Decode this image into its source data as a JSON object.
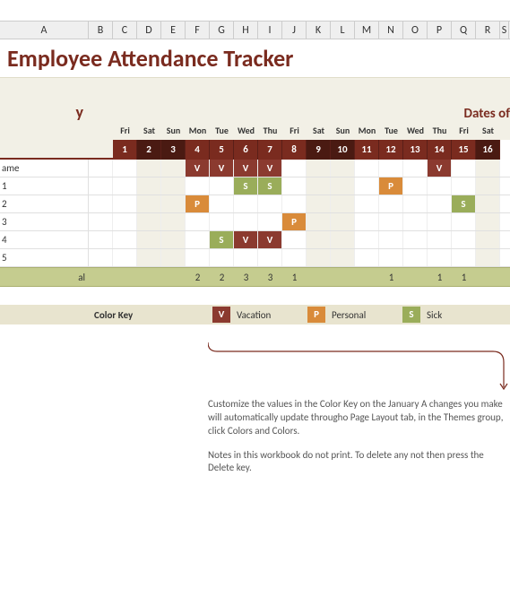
{
  "columns": [
    "A",
    "B",
    "C",
    "D",
    "E",
    "F",
    "G",
    "H",
    "I",
    "J",
    "K",
    "L",
    "M",
    "N",
    "O",
    "P",
    "Q",
    "R",
    "S"
  ],
  "title": "Employee Attendance Tracker",
  "month_suffix": "y",
  "dates_label": "Dates of",
  "dow": [
    "Fri",
    "Sat",
    "Sun",
    "Mon",
    "Tue",
    "Wed",
    "Thu",
    "Fri",
    "Sat",
    "Sun",
    "Mon",
    "Tue",
    "Wed",
    "Thu",
    "Fri",
    "Sat"
  ],
  "daynums": [
    "1",
    "2",
    "3",
    "4",
    "5",
    "6",
    "7",
    "8",
    "9",
    "10",
    "11",
    "12",
    "13",
    "14",
    "15",
    "16"
  ],
  "weekend_idx": [
    1,
    2,
    8,
    9,
    15
  ],
  "employees": [
    {
      "name": "ame",
      "cells": [
        "",
        "",
        "",
        "V",
        "V",
        "V",
        "V",
        "",
        "",
        "",
        "",
        "",
        "",
        "V",
        "",
        ""
      ]
    },
    {
      "name": "1",
      "cells": [
        "",
        "",
        "",
        "",
        "",
        "S",
        "S",
        "",
        "",
        "",
        "",
        "P",
        "",
        "",
        "",
        ""
      ]
    },
    {
      "name": "2",
      "cells": [
        "",
        "",
        "",
        "P",
        "",
        "",
        "",
        "",
        "",
        "",
        "",
        "",
        "",
        "",
        "S",
        ""
      ]
    },
    {
      "name": "3",
      "cells": [
        "",
        "",
        "",
        "",
        "",
        "",
        "",
        "P",
        "",
        "",
        "",
        "",
        "",
        "",
        "",
        ""
      ]
    },
    {
      "name": "4",
      "cells": [
        "",
        "",
        "",
        "",
        "S",
        "V",
        "V",
        "",
        "",
        "",
        "",
        "",
        "",
        "",
        "",
        ""
      ]
    },
    {
      "name": "5",
      "cells": [
        "",
        "",
        "",
        "",
        "",
        "",
        "",
        "",
        "",
        "",
        "",
        "",
        "",
        "",
        "",
        ""
      ]
    }
  ],
  "total_label": "al",
  "totals": [
    "",
    "",
    "",
    "2",
    "2",
    "3",
    "3",
    "1",
    "",
    "",
    "",
    "1",
    "",
    "1",
    "1",
    ""
  ],
  "color_key": {
    "label": "Color Key",
    "items": [
      {
        "code": "V",
        "text": "Vacation",
        "cls": "V"
      },
      {
        "code": "P",
        "text": "Personal",
        "cls": "P"
      },
      {
        "code": "S",
        "text": "Sick",
        "cls": "S"
      }
    ]
  },
  "note1": "Customize the values in the Color Key on the January A changes you make will automatically update througho Page Layout tab, in the Themes group, click Colors and Colors.",
  "note2": "Notes in this workbook do not print. To delete any not then press the Delete key."
}
